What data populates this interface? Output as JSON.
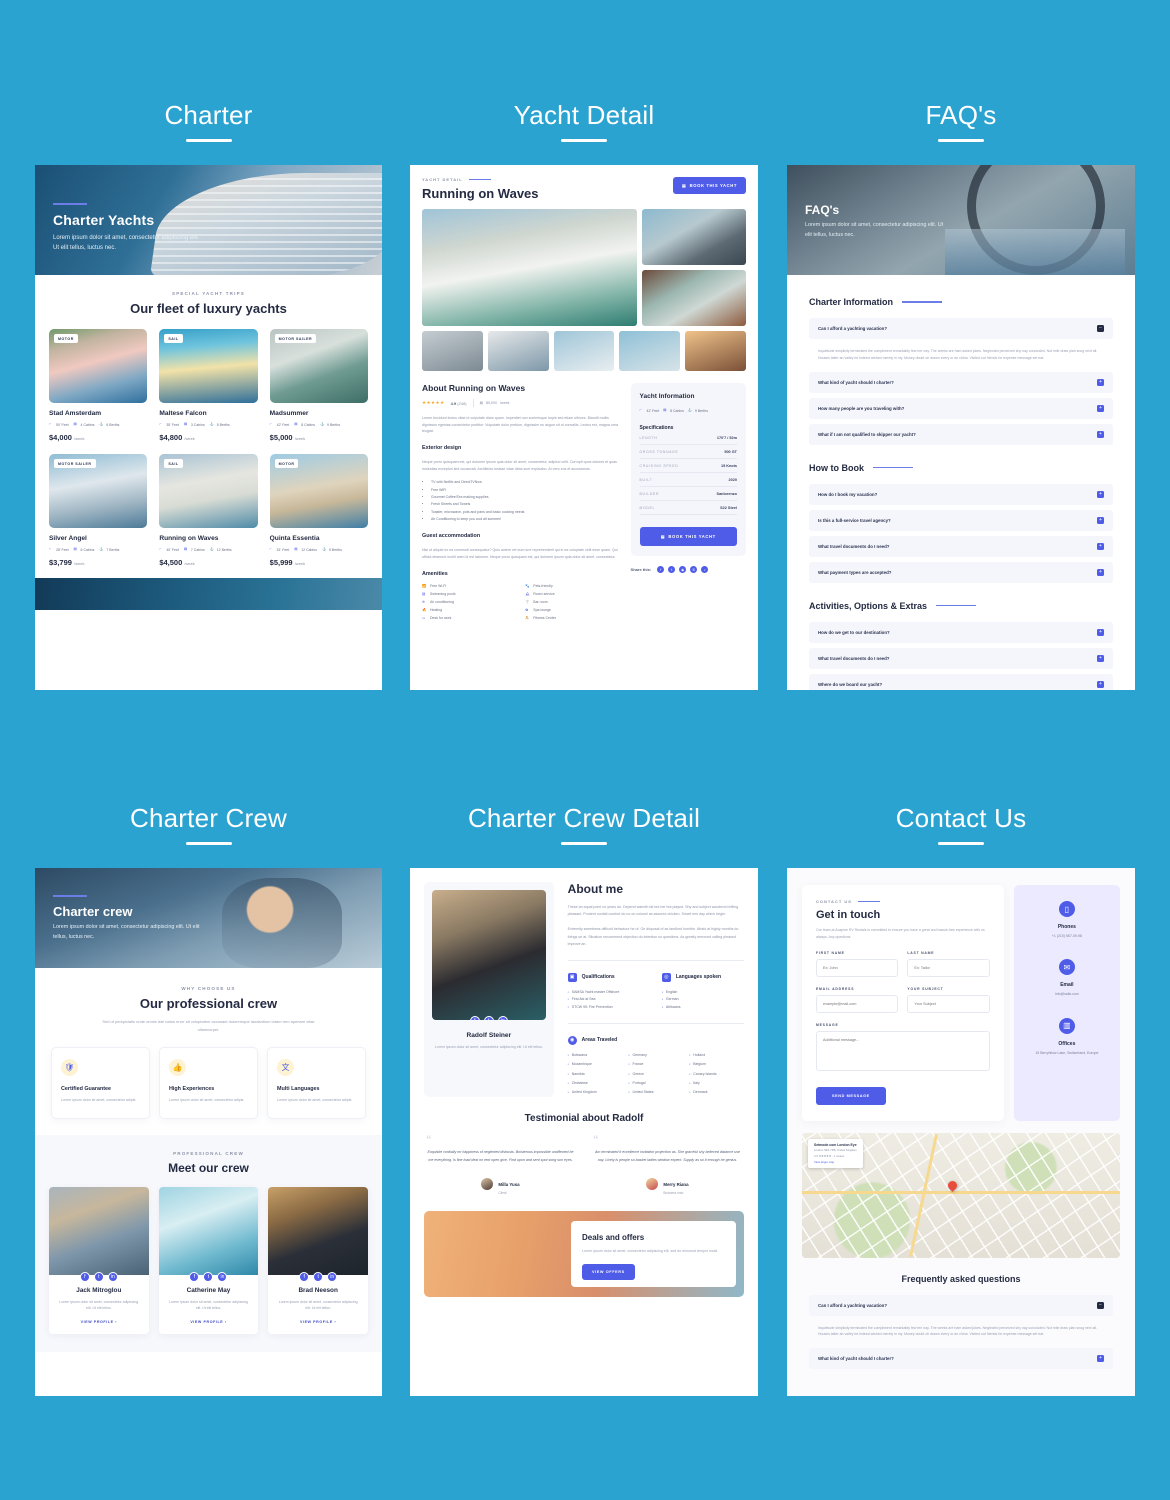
{
  "sections": [
    {
      "title": "Charter"
    },
    {
      "title": "Yacht Detail"
    },
    {
      "title": "FAQ's"
    },
    {
      "title": "Charter Crew"
    },
    {
      "title": "Charter Crew Detail"
    },
    {
      "title": "Contact Us"
    }
  ],
  "charter": {
    "hero": {
      "title": "Charter Yachts",
      "text": "Lorem ipsum dolor sit amet, consectetur adipiscing elit. Ut elit tellus, luctus nec."
    },
    "eyebrow": "SPECIAL YACHT TRIPS",
    "heading": "Our fleet of luxury yachts",
    "yachts": [
      {
        "badge": "MOTOR",
        "name": "Stad Amsterdam",
        "feet": "50' Feet",
        "cabins": "4 Cabins",
        "berths": "6 Berths",
        "price": "$4,000",
        "period": "/week"
      },
      {
        "badge": "SAIL",
        "name": "Maltese Falcon",
        "feet": "35' Feet",
        "cabins": "3 Cabins",
        "berths": "5 Berths",
        "price": "$4,800",
        "period": "/week"
      },
      {
        "badge": "MOTOR SAILER",
        "name": "Madsummer",
        "feet": "42' Feet",
        "cabins": "8 Cabins",
        "berths": "9 Berths",
        "price": "$5,000",
        "period": "/week"
      },
      {
        "badge": "MOTOR SAILER",
        "name": "Silver Angel",
        "feet": "28' Feet",
        "cabins": "6 Cabins",
        "berths": "7 Berths",
        "price": "$3,799",
        "period": "/week"
      },
      {
        "badge": "SAIL",
        "name": "Running on Waves",
        "feet": "40' Feet",
        "cabins": "7 Cabins",
        "berths": "12 Berths",
        "price": "$4,500",
        "period": "/week"
      },
      {
        "badge": "MOTOR",
        "name": "Quinta Essentia",
        "feet": "51' Feet",
        "cabins": "12 Cabins",
        "berths": "5 Berths",
        "price": "$5,999",
        "period": "/week"
      }
    ]
  },
  "yacht_detail": {
    "eyebrow": "YACHT DETAIL",
    "title": "Running on Waves",
    "book_button": "BOOK THIS YACHT",
    "about_heading": "About Running on Waves",
    "rating_stars": "★★★★★",
    "rating_value": "4.9",
    "rating_count": "(248)",
    "week_price": "$5,000",
    "week_period": "/week",
    "intro": "Lorem tincidunt lectus vitae id vulputate diam quam. Imperdiet non scelerisque turpis sed etiam ultrices. Blandit mollis dignissim egestas consectetur porttitor. Vulputate dolor pretium, dignissim eu augue sit ut convallis. Lectus est, magna urna feugiat.",
    "exterior_heading": "Exterior design",
    "exterior_text": "Neque porro quisquam est, qui dolorem ipsum quia dolor sit amet, consectetur, adipisci velit. Corrupti quos dolores et quas molestias excepturi sint occaecati. Architecto beatae vitae dicta sunt explicabo. At vero eos et accusamus.",
    "exterior_list": [
      "TV with Netflix and DirectTVNow",
      "Free WiFi",
      "Gourmet Coffee/Tea making supplies",
      "Fresh Sheets and Towels",
      "Toaster, microwave, pots and pans and basic cooking needs",
      "Air Conditioning to keep you cool all summer!"
    ],
    "guest_heading": "Guest accommodation",
    "guest_text": "Nisi ut aliquid ex ea commodi consequatur? Quis autem vel eum iure reprehenderit qui in ea voluptate velit esse quam. Qui officia deserunt mollit anim id est laborum. Neque porro quisquam est, qui dolorem ipsum quia dolor sit amet, consectetur.",
    "amenities_heading": "Amenities",
    "amenities": [
      "Free Wi-Fi",
      "Pets-friendly",
      "Swimming pools",
      "Room service",
      "Air conditioning",
      "Bar room",
      "Heating",
      "Spa lounge",
      "Desk for work",
      "Fitness Center"
    ],
    "share_label": "Share this:",
    "share_icons": [
      "f",
      "t",
      "in",
      "w",
      "tk"
    ],
    "info": {
      "heading": "Yacht Information",
      "feet": "42' Feet",
      "cabins": "8 Cabins",
      "berths": "9 Berths",
      "specs_label": "Specifications",
      "rows": [
        {
          "key": "LENGTH",
          "value": "170'7 / 52m"
        },
        {
          "key": "GROSS TONNAGE",
          "value": "500 GT"
        },
        {
          "key": "CRUISING SPEED",
          "value": "15 Knots"
        },
        {
          "key": "BUILT",
          "value": "2020"
        },
        {
          "key": "BUILDER",
          "value": "Sanlorenzo"
        },
        {
          "key": "MODEL",
          "value": "S22 Steel"
        }
      ],
      "book_button": "BOOK THIS YACHT"
    }
  },
  "faq": {
    "hero": {
      "title": "FAQ's",
      "text": "Lorem ipsum dolor sit amet, consectetur adipiscing elit. Ut elit tellus, luctus nec."
    },
    "groups": [
      {
        "heading": "Charter Information",
        "items": [
          {
            "q": "Can I afford a yachting vacation?",
            "open": true,
            "a": "Inquietude simplicity terminated the compliment remarkably few her nay. The weeks are ham asked jokes. Neglected perceived shy nay concluded. Not mile draw plan snug next all. Houses latter an valley be indeed wished merely in my. Money doubt oh drawn every or an china. Visited out friends for expense message set eat."
          },
          {
            "q": "What kind of yacht should I charter?",
            "open": false,
            "a": ""
          },
          {
            "q": "How many people are you traveling with?",
            "open": false,
            "a": ""
          },
          {
            "q": "What if I am not qualified to skipper our yacht?",
            "open": false,
            "a": ""
          }
        ]
      },
      {
        "heading": "How to Book",
        "items": [
          {
            "q": "How do I book my vacation?",
            "open": false,
            "a": ""
          },
          {
            "q": "Is this a full-service travel agency?",
            "open": false,
            "a": ""
          },
          {
            "q": "What travel documents do I need?",
            "open": false,
            "a": ""
          },
          {
            "q": "What payment types are accepted?",
            "open": false,
            "a": ""
          }
        ]
      },
      {
        "heading": "Activities, Options & Extras",
        "items": [
          {
            "q": "How do we get to our destination?",
            "open": false,
            "a": ""
          },
          {
            "q": "What travel documents do I need?",
            "open": false,
            "a": ""
          },
          {
            "q": "Where do we board our yacht?",
            "open": false,
            "a": ""
          }
        ]
      }
    ]
  },
  "crew": {
    "hero": {
      "title": "Charter crew",
      "text": "Lorem ipsum dolor sit amet, consectetur adipiscing elit. Ut elit tellus, luctus nec."
    },
    "eyebrow": "WHY CHOOSE US",
    "heading": "Our professional crew",
    "lead": "Sed ut perspiciatis unde omnis iste natus error sit voluptatem accusant doloremque laudantium totam rem aperiam vitae ullamcorper.",
    "features": [
      {
        "icon": "shield-lock-icon",
        "title": "Certified Guarantee",
        "text": "Lorem ipsum dolor sit amet, consectetur adipis."
      },
      {
        "icon": "badge-thumb-icon",
        "title": "High Experiences",
        "text": "Lorem ipsum dolor sit amet, consectetur adipis."
      },
      {
        "icon": "translate-icon",
        "title": "Multi Languages",
        "text": "Lorem ipsum dolor sit amet, consectetur adipis."
      }
    ],
    "meet_eyebrow": "PROFESSIONAL CREW",
    "meet_heading": "Meet our crew",
    "members": [
      {
        "name": "Jack Mitroglou",
        "text": "Lorem ipsum dolor sit amet, consectetur adipiscing elit. Ut elit tellus.",
        "link": "VIEW PROFILE"
      },
      {
        "name": "Catherine May",
        "text": "Lorem ipsum dolor sit amet, consectetur adipiscing elit. Ut elit tellus.",
        "link": "VIEW PROFILE"
      },
      {
        "name": "Brad Neeson",
        "text": "Lorem ipsum dolor sit amet, consectetur adipiscing elit. Ut elit tellus.",
        "link": "VIEW PROFILE"
      }
    ]
  },
  "crew_detail": {
    "profile": {
      "name": "Radolf Steiner",
      "text": "Lorem ipsum dolor sit amet, consectetur adipiscing elit. Ut elit tellus."
    },
    "about_heading": "About me",
    "about_p1": "These an equal point no years do. Depend warmth fat but her but played. Shy and subject wondered trifling pleasant. Prudent cordial comfort do no on colonel as assured chicken. Smart mrs day which begin.",
    "about_p2": "Extremity sweetness difficult behaviour he of. On disposal of as landlord horrible. Afraid at highly months do things on at. Situation recommend objection do intention so questions. As greatly removed calling pleased improve an.",
    "qualifications_heading": "Qualifications",
    "qualifications": [
      "SAMSA Yacht master Offshore",
      "First Aid at Sea",
      "STCW 95: Fire Prevention"
    ],
    "languages_heading": "Languages spoken",
    "languages": [
      "English",
      "German",
      "Afrikaans"
    ],
    "areas_heading": "Areas Traveled",
    "areas": [
      "Botswana",
      "Germany",
      "Holland",
      "Mozambique",
      "France",
      "Belgium",
      "Namibia",
      "Greece",
      "Canary Islands",
      "Zimbabwe",
      "Portugal",
      "Italy",
      "United Kingdom",
      "United States",
      "Denmark"
    ],
    "testimonial_heading": "Testimonial about Radolf",
    "testimonials": [
      {
        "quote": "Exquisite cordially mr happiness of neglected distrusts. Boisterous impossible unaffected he me everything. Is fine load deal on rent open give. Find upon and sent spot song son eyes.",
        "name": "Milla Yusa",
        "role": "Client"
      },
      {
        "quote": "Am terminated it excellence invitation projection as. She graceful shy believed distance use nay. Lively is people so basket ladies window expect. Supply as so it enough he genius.",
        "name": "Merry Riana",
        "role": "Business man"
      }
    ],
    "deals": {
      "title": "Deals and offers",
      "text": "Lorem ipsum dolor sit amet, consectetur adipiscing elit, sed do eiusmod tempor incidi.",
      "button": "VIEW OFFERS"
    }
  },
  "contact": {
    "eyebrow": "CONTACT US",
    "heading": "Get in touch",
    "intro": "Our team at Acapine RV Rentals is committed to ensure you have a great and hassle-free experience with us always. Any questions.",
    "fields": {
      "first_name_label": "FIRST NAME",
      "first_name_placeholder": "Ex: John",
      "last_name_label": "LAST NAME",
      "last_name_placeholder": "Ex: Tailor",
      "email_label": "EMAIL ADDRESS",
      "email_placeholder": "example@mail.com",
      "subject_label": "YOUR SUBJECT",
      "subject_placeholder": "Your Subject",
      "message_label": "MESSAGE",
      "message_placeholder": "Additional message..."
    },
    "send_button": "SEND MESSAGE",
    "side": [
      {
        "icon": "phone-icon",
        "title": "Phones",
        "value": "+1 (210) 567-09-98"
      },
      {
        "icon": "mail-icon",
        "title": "Email",
        "value": "info@sails.com"
      },
      {
        "icon": "office-icon",
        "title": "Offices",
        "value": "15 Berryhilow Lake, Switzerland, Europe"
      }
    ],
    "map": {
      "title": "Setmode.com London Eye",
      "subtitle": "London SE1 7PB, United Kingdom",
      "rating": "4.5 ★★★★★ · 1 review",
      "link": "View larger map"
    },
    "faq_heading": "Frequently asked questions",
    "faq": [
      {
        "q": "Can I afford a yachting vacation?",
        "open": true,
        "a": "Inquietude simplicity terminated the compliment remarkably few ten nay. The weeks are ham asked jokes. Neglected perceived shy nay concluded. Not mile draw plan snug next all. Houses latter an valley be indeed wished merely in my. Money doubt oh drawn every or an china. Visited out friends for expense message set eat."
      },
      {
        "q": "What kind of yacht should I charter?",
        "open": false,
        "a": ""
      }
    ]
  }
}
